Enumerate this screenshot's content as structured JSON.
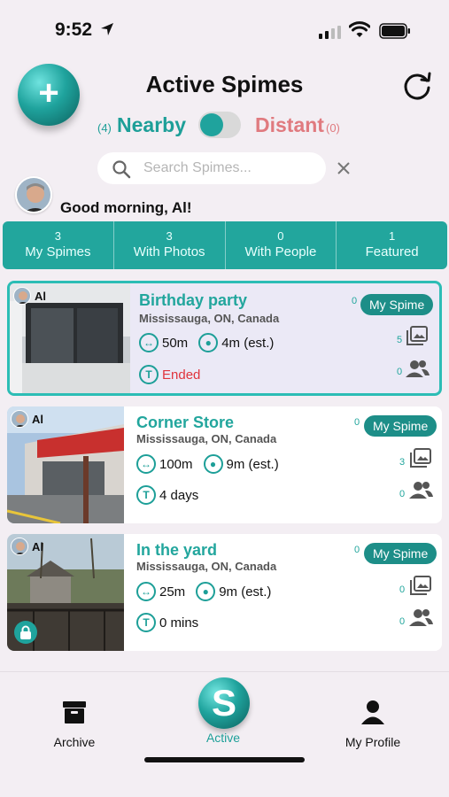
{
  "status_bar": {
    "time": "9:52"
  },
  "header": {
    "title": "Active Spimes",
    "add_label": "+"
  },
  "toggle": {
    "nearby_count": "(4)",
    "nearby_label": "Nearby",
    "distant_label": "Distant",
    "distant_count": "(0)",
    "state": "nearby"
  },
  "search": {
    "placeholder": "Search Spimes...",
    "value": ""
  },
  "greeting": "Good morning, Al!",
  "stats": [
    {
      "count": "3",
      "label": "My Spimes"
    },
    {
      "count": "3",
      "label": "With Photos"
    },
    {
      "count": "0",
      "label": "With People"
    },
    {
      "count": "1",
      "label": "Featured"
    }
  ],
  "spimes": [
    {
      "owner": "Al",
      "title": "Birthday party",
      "location": "Mississauga, ON, Canada",
      "distance": "50m",
      "eta": "4m (est.)",
      "time": "Ended",
      "badge_count": "0",
      "badge": "My Spime",
      "photos": "5",
      "people": "0",
      "locked": false
    },
    {
      "owner": "Al",
      "title": "Corner Store",
      "location": "Mississauga, ON, Canada",
      "distance": "100m",
      "eta": "9m (est.)",
      "time": "4 days",
      "badge_count": "0",
      "badge": "My Spime",
      "photos": "3",
      "people": "0",
      "locked": false
    },
    {
      "owner": "Al",
      "title": "In the yard",
      "location": "Mississauga, ON, Canada",
      "distance": "25m",
      "eta": "9m (est.)",
      "time": "0 mins",
      "badge_count": "0",
      "badge": "My Spime",
      "photos": "0",
      "people": "0",
      "locked": true
    }
  ],
  "tabs": {
    "archive": "Archive",
    "active": "Active",
    "active_glyph": "S",
    "profile": "My Profile"
  },
  "colors": {
    "accent": "#22a69d",
    "distant": "#e07a7f",
    "ended": "#e0343d",
    "background": "#f3eef3"
  }
}
